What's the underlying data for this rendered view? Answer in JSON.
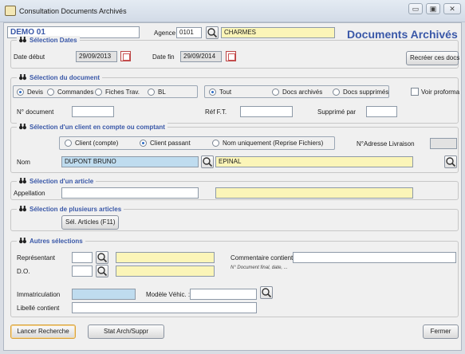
{
  "window": {
    "title": "Consultation Documents Archivés",
    "minimize": "▭",
    "maximize": "▣",
    "close": "✕"
  },
  "header": {
    "company": "DEMO 01",
    "agence_label": "Agence",
    "agence_code": "0101",
    "agence_name": "CHARMES",
    "page_title": "Documents Archivés"
  },
  "dates": {
    "title": "Sélection Dates",
    "debut_label": "Date début",
    "debut_value": "29/09/2013",
    "fin_label": "Date fin",
    "fin_value": "29/09/2014",
    "recreate_button": "Recréer ces docs"
  },
  "document": {
    "title": "Sélection du document",
    "types": [
      "Devis",
      "Commandes",
      "Fiches Trav.",
      "BL"
    ],
    "status": [
      "Tout",
      "Docs archivés",
      "Docs supprimés"
    ],
    "status_selected": "Tout",
    "proforma_label": "Voir proforma",
    "num_label": "N° document",
    "ref_label": "Réf F.T.",
    "suppr_label": "Supprimé par"
  },
  "client": {
    "title": "Sélection d'un client en compte ou comptant",
    "options": [
      "Client (compte)",
      "Client passant",
      "Nom uniquement (Reprise Fichiers)"
    ],
    "selected": "Client passant",
    "adresse_label": "N°Adresse Livraison",
    "nom_label": "Nom",
    "nom_value": "DUPONT BRUNO",
    "ville_value": "EPINAL"
  },
  "article": {
    "title": "Sélection d'un article",
    "appellation_label": "Appellation"
  },
  "articles": {
    "title": "Sélection de plusieurs articles",
    "button": "Sél. Articles (F11)"
  },
  "autres": {
    "title": "Autres sélections",
    "representant_label": "Représentant",
    "do_label": "D.O.",
    "commentaire_label": "Commentaire contient",
    "commentaire_hint": "N° Document final, date, ...",
    "immat_label": "Immatriculation",
    "modele_label": "Modèle Véhic. :",
    "libelle_label": "Libellé contient"
  },
  "footer": {
    "search_button": "Lancer Recherche",
    "stat_button": "Stat Arch/Suppr",
    "close_button": "Fermer"
  },
  "colors": {
    "accent": "#3a58a8",
    "yellow_field": "#fbf5b8",
    "blue_field": "#bfdcef"
  },
  "icons": {
    "search": "magnifier-icon",
    "calendar": "calendar-icon",
    "binoculars": "binoculars-icon"
  }
}
